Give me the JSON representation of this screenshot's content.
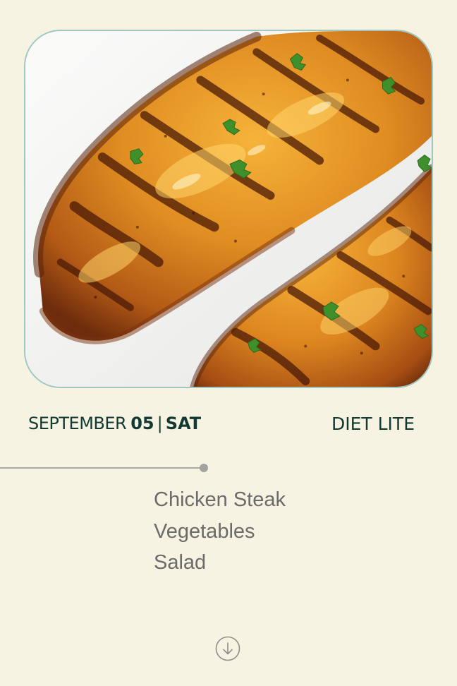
{
  "header": {
    "photo_alt": "Grilled chicken breasts garnished with parsley"
  },
  "date": {
    "month": "SEPTEMBER",
    "day": "05",
    "separator": "|",
    "weekday": "SAT"
  },
  "plan": {
    "name": "DIET LITE"
  },
  "menu": {
    "items": [
      {
        "label": "Chicken Steak"
      },
      {
        "label": "Vegetables"
      },
      {
        "label": "Salad"
      }
    ]
  },
  "actions": {
    "scroll_icon": "arrow-down-circle-icon"
  },
  "colors": {
    "background": "#f6f3e2",
    "accent_dark": "#123a33",
    "menu_text": "#6b6b6b",
    "photo_border": "#9fc8c2"
  }
}
